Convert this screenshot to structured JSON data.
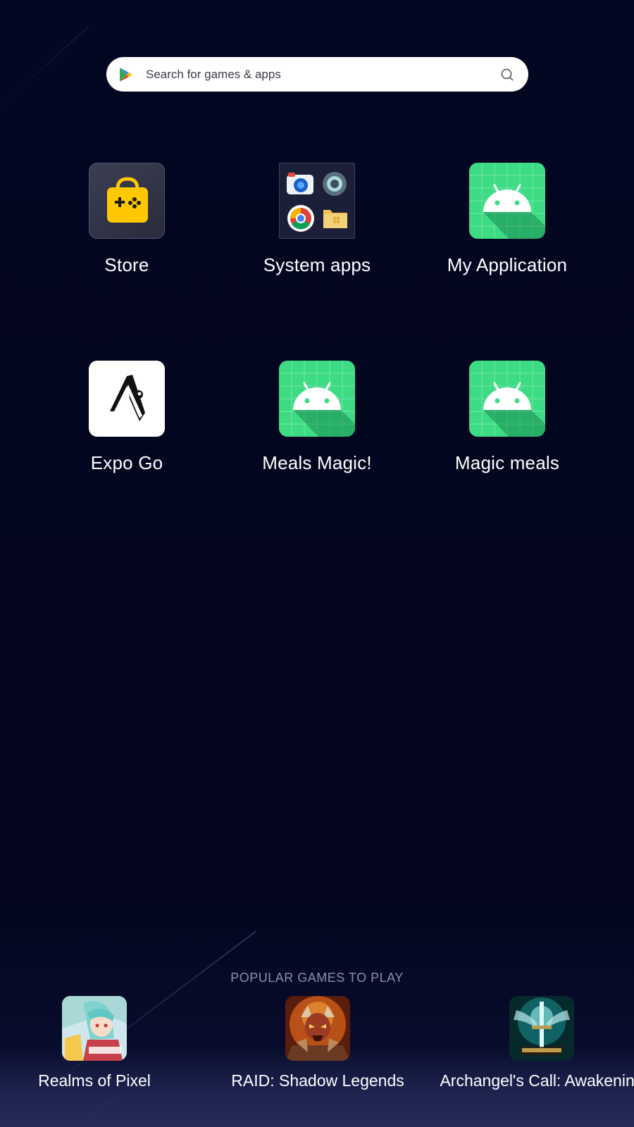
{
  "search": {
    "placeholder": "Search for games & apps",
    "logo_icon": "google-play-icon",
    "search_icon": "search-icon"
  },
  "apps": [
    {
      "label": "Store",
      "icon": "store-bag-gamepad-icon"
    },
    {
      "label": "System apps",
      "icon": "system-apps-folder-icon"
    },
    {
      "label": "My Application",
      "icon": "android-icon"
    },
    {
      "label": "Expo Go",
      "icon": "expo-go-icon"
    },
    {
      "label": "Meals Magic!",
      "icon": "android-icon"
    },
    {
      "label": "Magic meals",
      "icon": "android-icon"
    }
  ],
  "popular": {
    "title": "POPULAR GAMES TO PLAY",
    "games": [
      {
        "label": "Realms of Pixel",
        "icon": "realms-of-pixel-icon"
      },
      {
        "label": "RAID: Shadow Legends",
        "icon": "raid-shadow-legends-icon"
      },
      {
        "label": "Archangel's Call: Awakening",
        "icon": "archangels-call-icon"
      }
    ]
  },
  "colors": {
    "background": "#03061f",
    "android_green": "#3ddc84",
    "store_yellow": "#ffc800",
    "popular_title": "#8a8fae"
  }
}
